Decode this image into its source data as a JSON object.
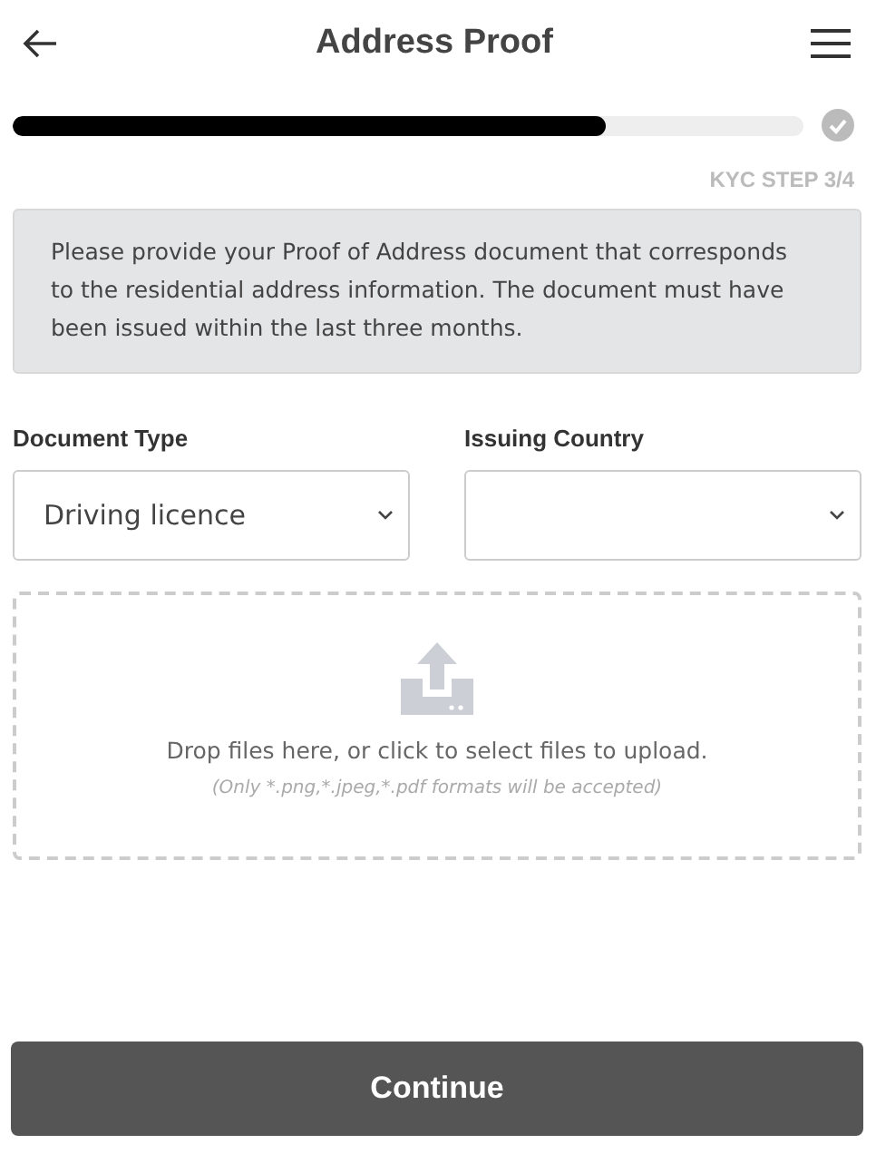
{
  "header": {
    "title": "Address Proof"
  },
  "progress": {
    "level": 0.75,
    "step": "KYC STEP 3/4"
  },
  "notice": "Please provide your Proof of Address document that corresponds to the residential address information. The document must have been issued within the last three months.",
  "fields": [
    {
      "label": "Document Type",
      "value": "Driving licence"
    },
    {
      "label": "Issuing Country"
    }
  ],
  "upload": {
    "prompt": "Drop files here, or click to select files to upload.",
    "hint": "(Only *.png,*.jpeg,*.pdf formats will be accepted)"
  },
  "continue_button": "Continue"
}
